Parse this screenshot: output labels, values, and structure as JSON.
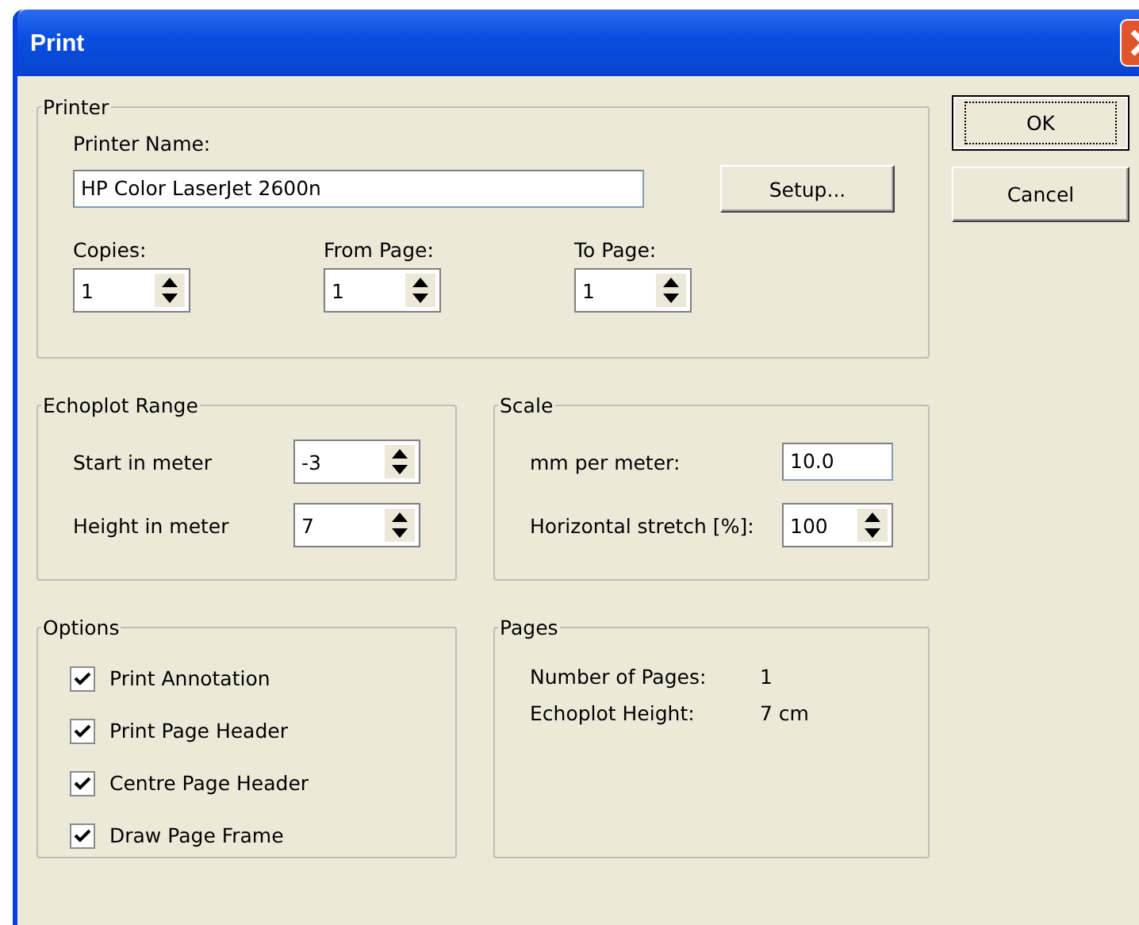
{
  "window": {
    "title": "Print"
  },
  "printer": {
    "title": "Printer",
    "name_label": "Printer Name:",
    "name_value": "HP Color LaserJet 2600n",
    "setup_button": "Setup...",
    "spinners": [
      {
        "label": "Copies:",
        "value": "1"
      },
      {
        "label": "From Page:",
        "value": "1"
      },
      {
        "label": "To Page:",
        "value": "1"
      }
    ]
  },
  "echoplot_range": {
    "title": "Echoplot Range",
    "rows": [
      {
        "label": "Start in meter",
        "value": "-3",
        "kind": "spinner"
      },
      {
        "label": "Height in meter",
        "value": "7",
        "kind": "spinner"
      }
    ]
  },
  "scale": {
    "title": "Scale",
    "rows": [
      {
        "label": "mm per meter:",
        "value": "10.0",
        "kind": "text"
      },
      {
        "label": "Horizontal stretch [%]:",
        "value": "100",
        "kind": "spinner"
      }
    ]
  },
  "options": {
    "title": "Options",
    "items": [
      {
        "label": "Print Annotation",
        "checked": true
      },
      {
        "label": "Print Page Header",
        "checked": true
      },
      {
        "label": "Centre Page Header",
        "checked": true
      },
      {
        "label": "Draw Page Frame",
        "checked": true
      }
    ]
  },
  "pages": {
    "title": "Pages",
    "rows": [
      {
        "label": "Number of Pages:",
        "value": "1"
      },
      {
        "label": "Echoplot Height:",
        "value": "7 cm"
      }
    ]
  },
  "buttons": [
    {
      "label": "OK",
      "default": true
    },
    {
      "label": "Cancel",
      "default": false
    }
  ]
}
